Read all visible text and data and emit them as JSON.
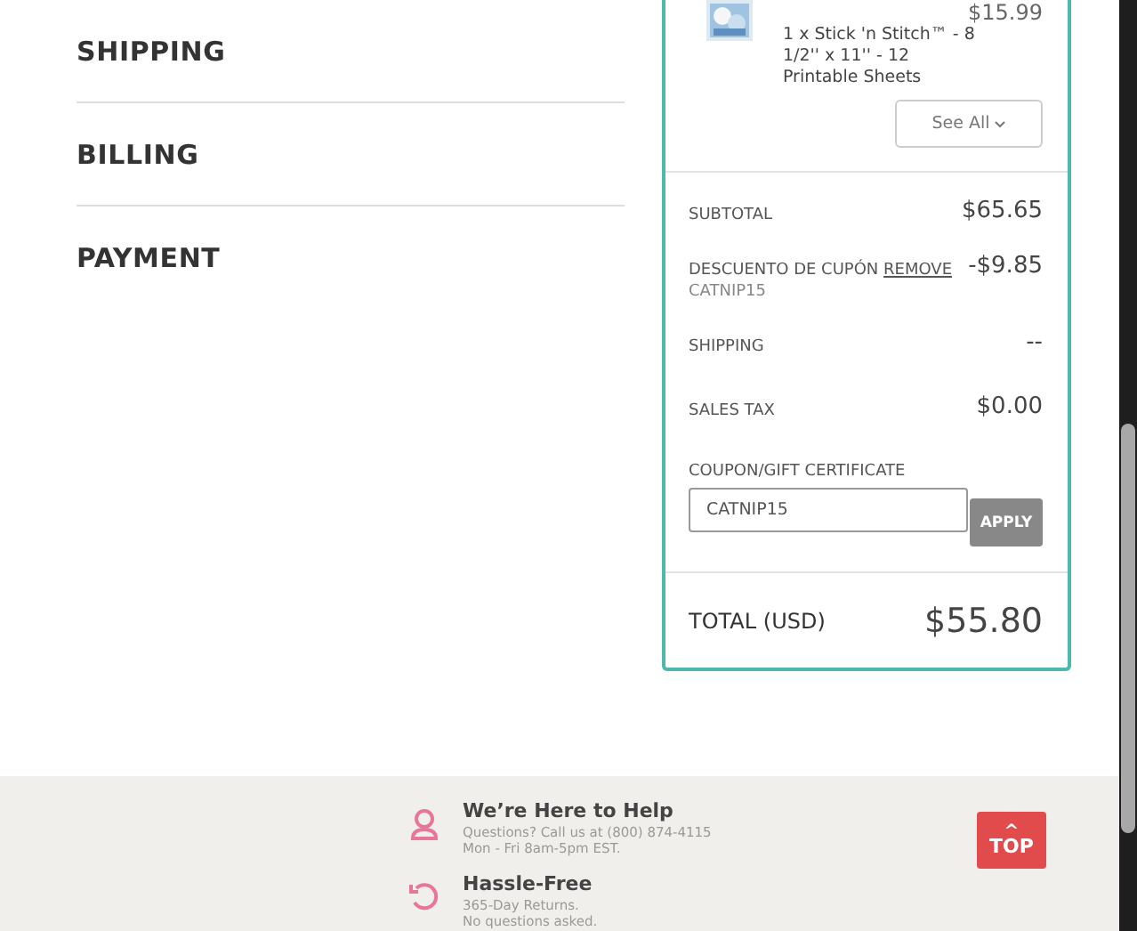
{
  "sections": [
    {
      "title": "SHIPPING"
    },
    {
      "title": "BILLING"
    },
    {
      "title": "PAYMENT"
    }
  ],
  "cart_item": {
    "price": "$15.99",
    "description": "1 x Stick 'n Stitch™ - 8 1/2'' x 11'' - 12 Printable Sheets"
  },
  "see_all": "See All",
  "summary": [
    {
      "kind": "plain",
      "label": "SUBTOTAL",
      "value": "$65.65"
    },
    {
      "kind": "coupon",
      "label": "DESCUENTO DE CUPÓN",
      "link": "REMOVE",
      "code": "CATNIP15",
      "value": "-$9.85"
    },
    {
      "kind": "plain",
      "label": "SHIPPING",
      "value": "--"
    },
    {
      "kind": "plain",
      "label": "SALES TAX",
      "value": "$0.00"
    }
  ],
  "coupon_field": {
    "label": "COUPON/GIFT CERTIFICATE",
    "value": "CATNIP15",
    "button": "APPLY"
  },
  "total": {
    "label": "TOTAL (USD)",
    "value": "$55.80"
  },
  "footer": [
    {
      "kind": "help",
      "title": "We’re Here to Help",
      "lines": [
        "Questions? Call us at (800) 874-4115",
        "Mon - Fri 8am-5pm EST."
      ]
    },
    {
      "kind": "returns",
      "title": "Hassle-Free",
      "lines": [
        "365-Day Returns.",
        "No questions asked."
      ]
    }
  ],
  "top_button": {
    "icon": "^",
    "label": "TOP"
  }
}
